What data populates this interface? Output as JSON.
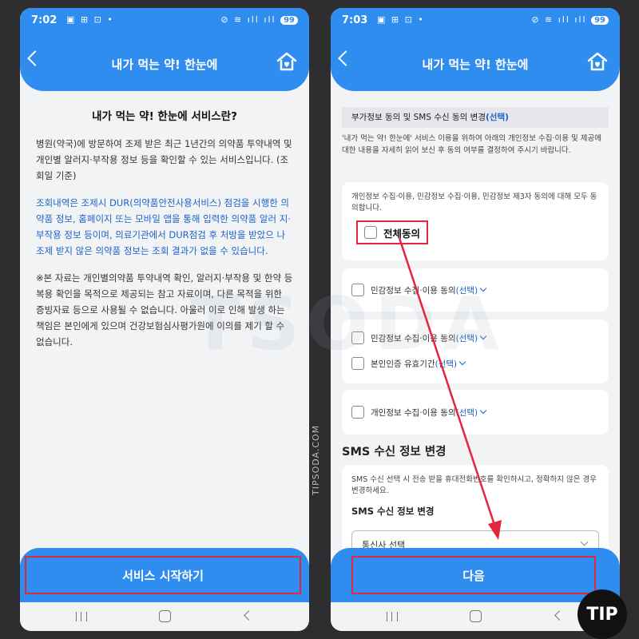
{
  "left": {
    "status": {
      "time": "7:02",
      "icons": "▣ ⊞ ⊡ •",
      "right": "⊘ ≋ ıll ıll",
      "battery": "99"
    },
    "header_title": "내가 먹는 약! 한눈에",
    "intro_title": "내가 먹는 약! 한눈에 서비스란?",
    "para1": "병원(약국)에 방문하여 조제 받은 최근 1년간의 의약품 투약내역 및 개인별 알러지·부작용 정보 등을 확인할 수 있는 서비스입니다. (조회일 기준)",
    "para2": "조회내역은 조제시 DUR(의약품안전사용서비스) 점검을 시행한 의약품 정보, 홈페이지 또는 모바일 앱을 통해 입력한 의약품 알러 지·부작용 정보 등이며, 의료기관에서 DUR점검 후 처방을 받았으 나 조제 받지 않은 의약품 정보는 조회 결과가 없을 수 있습니다.",
    "para3": "※본 자료는 개인별의약품 투약내역 확인, 알러지·부작용 및 한약 등 복용 확인을 목적으로 제공되는 참고 자료이며, 다른 목적을 위한 증빙자료 등으로 사용될 수 없습니다. 아울러 이로 인해 발생 하는 책임은 본인에게 있으며 건강보험심사평가원에 이의를 제기 할 수 없습니다.",
    "start_button": "서비스 시작하기"
  },
  "right": {
    "status": {
      "time": "7:03",
      "icons": "▣ ⊞ ⊡ •",
      "right": "⊘ ≋ ıll ıll",
      "battery": "99"
    },
    "header_title": "내가 먹는 약! 한눈에",
    "section_head": "부가정보 동의 및 SMS 수신 동의 변경",
    "section_head_opt": "(선택)",
    "section_desc": "'내가 먹는 약! 한눈에' 서비스 이용을 위하여 아래의 개인정보 수집·이용 및 제공에 대한 내용을 자세히 읽어 보신 후 동의 여부를 결정하여 주시기 바랍니다.",
    "consent_desc": "개인정보 수집·이용, 민감정보 수집·이용, 민감정보 제3자 동의에 대해 모두 동의합니다.",
    "all_agree": "전체동의",
    "items": [
      {
        "label": "민감정보 수집·이용 동의",
        "opt": "(선택)"
      },
      {
        "label": "민감정보 수집·이용 동의",
        "opt": "(선택)"
      },
      {
        "label": "본인인증 유효기간",
        "opt": "(선택)"
      },
      {
        "label": "개인정보 수집·이용 동의",
        "opt": "(선택)"
      }
    ],
    "sms_title": "SMS 수신 정보 변경",
    "sms_desc": "SMS 수신 선택 시 전송 받을 휴대전화번호를 확인하시고, 정확하지 않은 경우 변경하세요.",
    "sms_sub": "SMS 수신 정보 변경",
    "carrier_select": "통신사 선택",
    "next_button": "다음"
  },
  "watermark": "TSODA",
  "vertical_site": "TIPSODA.COM",
  "tip_badge": "TIP",
  "colors": {
    "primary": "#2f8df0",
    "highlight": "#e3263c",
    "link": "#1a63c9"
  }
}
